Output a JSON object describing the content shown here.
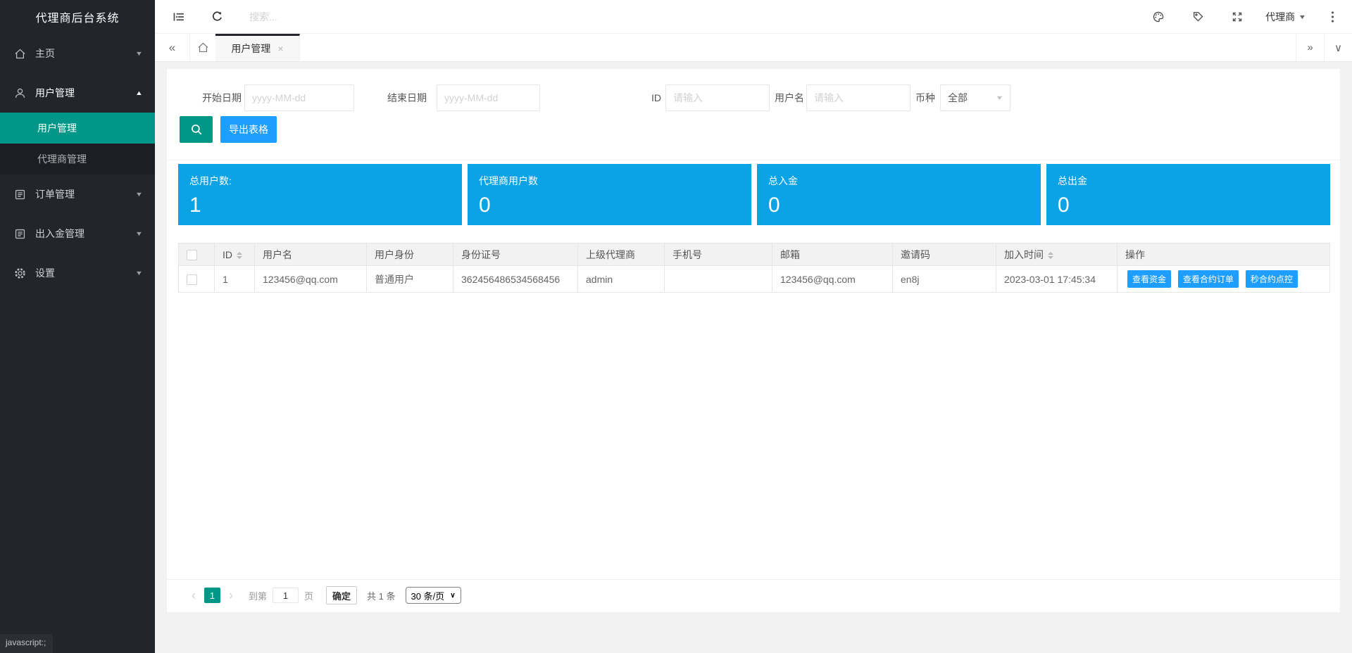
{
  "app": {
    "title": "代理商后台系统"
  },
  "colors": {
    "accent_teal": "#009688",
    "accent_blue": "#1e9fff",
    "stat_card_blue": "#09a3e6",
    "sidebar_bg": "#22252c"
  },
  "sidebar": {
    "items": [
      {
        "label": "主页",
        "icon": "home-icon",
        "caret": "▼"
      },
      {
        "label": "用户管理",
        "icon": "user-icon",
        "caret": "▲",
        "children": [
          {
            "label": "用户管理",
            "active": true
          },
          {
            "label": "代理商管理",
            "active": false
          }
        ]
      },
      {
        "label": "订单管理",
        "icon": "order-icon",
        "caret": "▼"
      },
      {
        "label": "出入金管理",
        "icon": "funds-icon",
        "caret": "▼"
      },
      {
        "label": "设置",
        "icon": "settings-icon",
        "caret": "▼"
      }
    ],
    "link_hint": "javascript:;"
  },
  "topbar": {
    "search_placeholder": "搜索...",
    "user_menu": "代理商",
    "user_caret": "▼"
  },
  "tabbar": {
    "collapse_left": "«",
    "active_tab": "用户管理",
    "close": "×",
    "more_right": "»",
    "collapse_down": "∨"
  },
  "filters": {
    "start_date": {
      "label": "开始日期",
      "placeholder": "yyyy-MM-dd"
    },
    "end_date": {
      "label": "结束日期",
      "placeholder": "yyyy-MM-dd"
    },
    "id": {
      "label": "ID",
      "placeholder": "请输入"
    },
    "username": {
      "label": "用户名",
      "placeholder": "请输入"
    },
    "currency": {
      "label": "币种",
      "value": "全部",
      "caret": "▼"
    },
    "export_label": "导出表格"
  },
  "stats": {
    "cards": [
      {
        "label": "总用户数:",
        "value": "1"
      },
      {
        "label": "代理商用户数",
        "value": "0"
      },
      {
        "label": "总入金",
        "value": "0"
      },
      {
        "label": "总出金",
        "value": "0"
      }
    ]
  },
  "table": {
    "columns": [
      "ID",
      "用户名",
      "用户身份",
      "身份证号",
      "上级代理商",
      "手机号",
      "邮箱",
      "邀请码",
      "加入时间",
      "操作"
    ],
    "rows": [
      {
        "id": "1",
        "username": "123456@qq.com",
        "role": "普通用户",
        "id_card": "362456486534568456",
        "parent_agent": "admin",
        "phone": "",
        "email": "123456@qq.com",
        "invite_code": "en8j",
        "join_time": "2023-03-01 17:45:34",
        "actions": [
          "查看资金",
          "查看合约订单",
          "秒合约点控"
        ]
      }
    ]
  },
  "pagination": {
    "prev": "‹",
    "current_page": "1",
    "next": "›",
    "goto_label": "到第",
    "goto_value": "1",
    "page_label": "页",
    "confirm_label": "确定",
    "total_label": "共 1 条",
    "page_size": "30 条/页",
    "size_caret": "∨"
  }
}
